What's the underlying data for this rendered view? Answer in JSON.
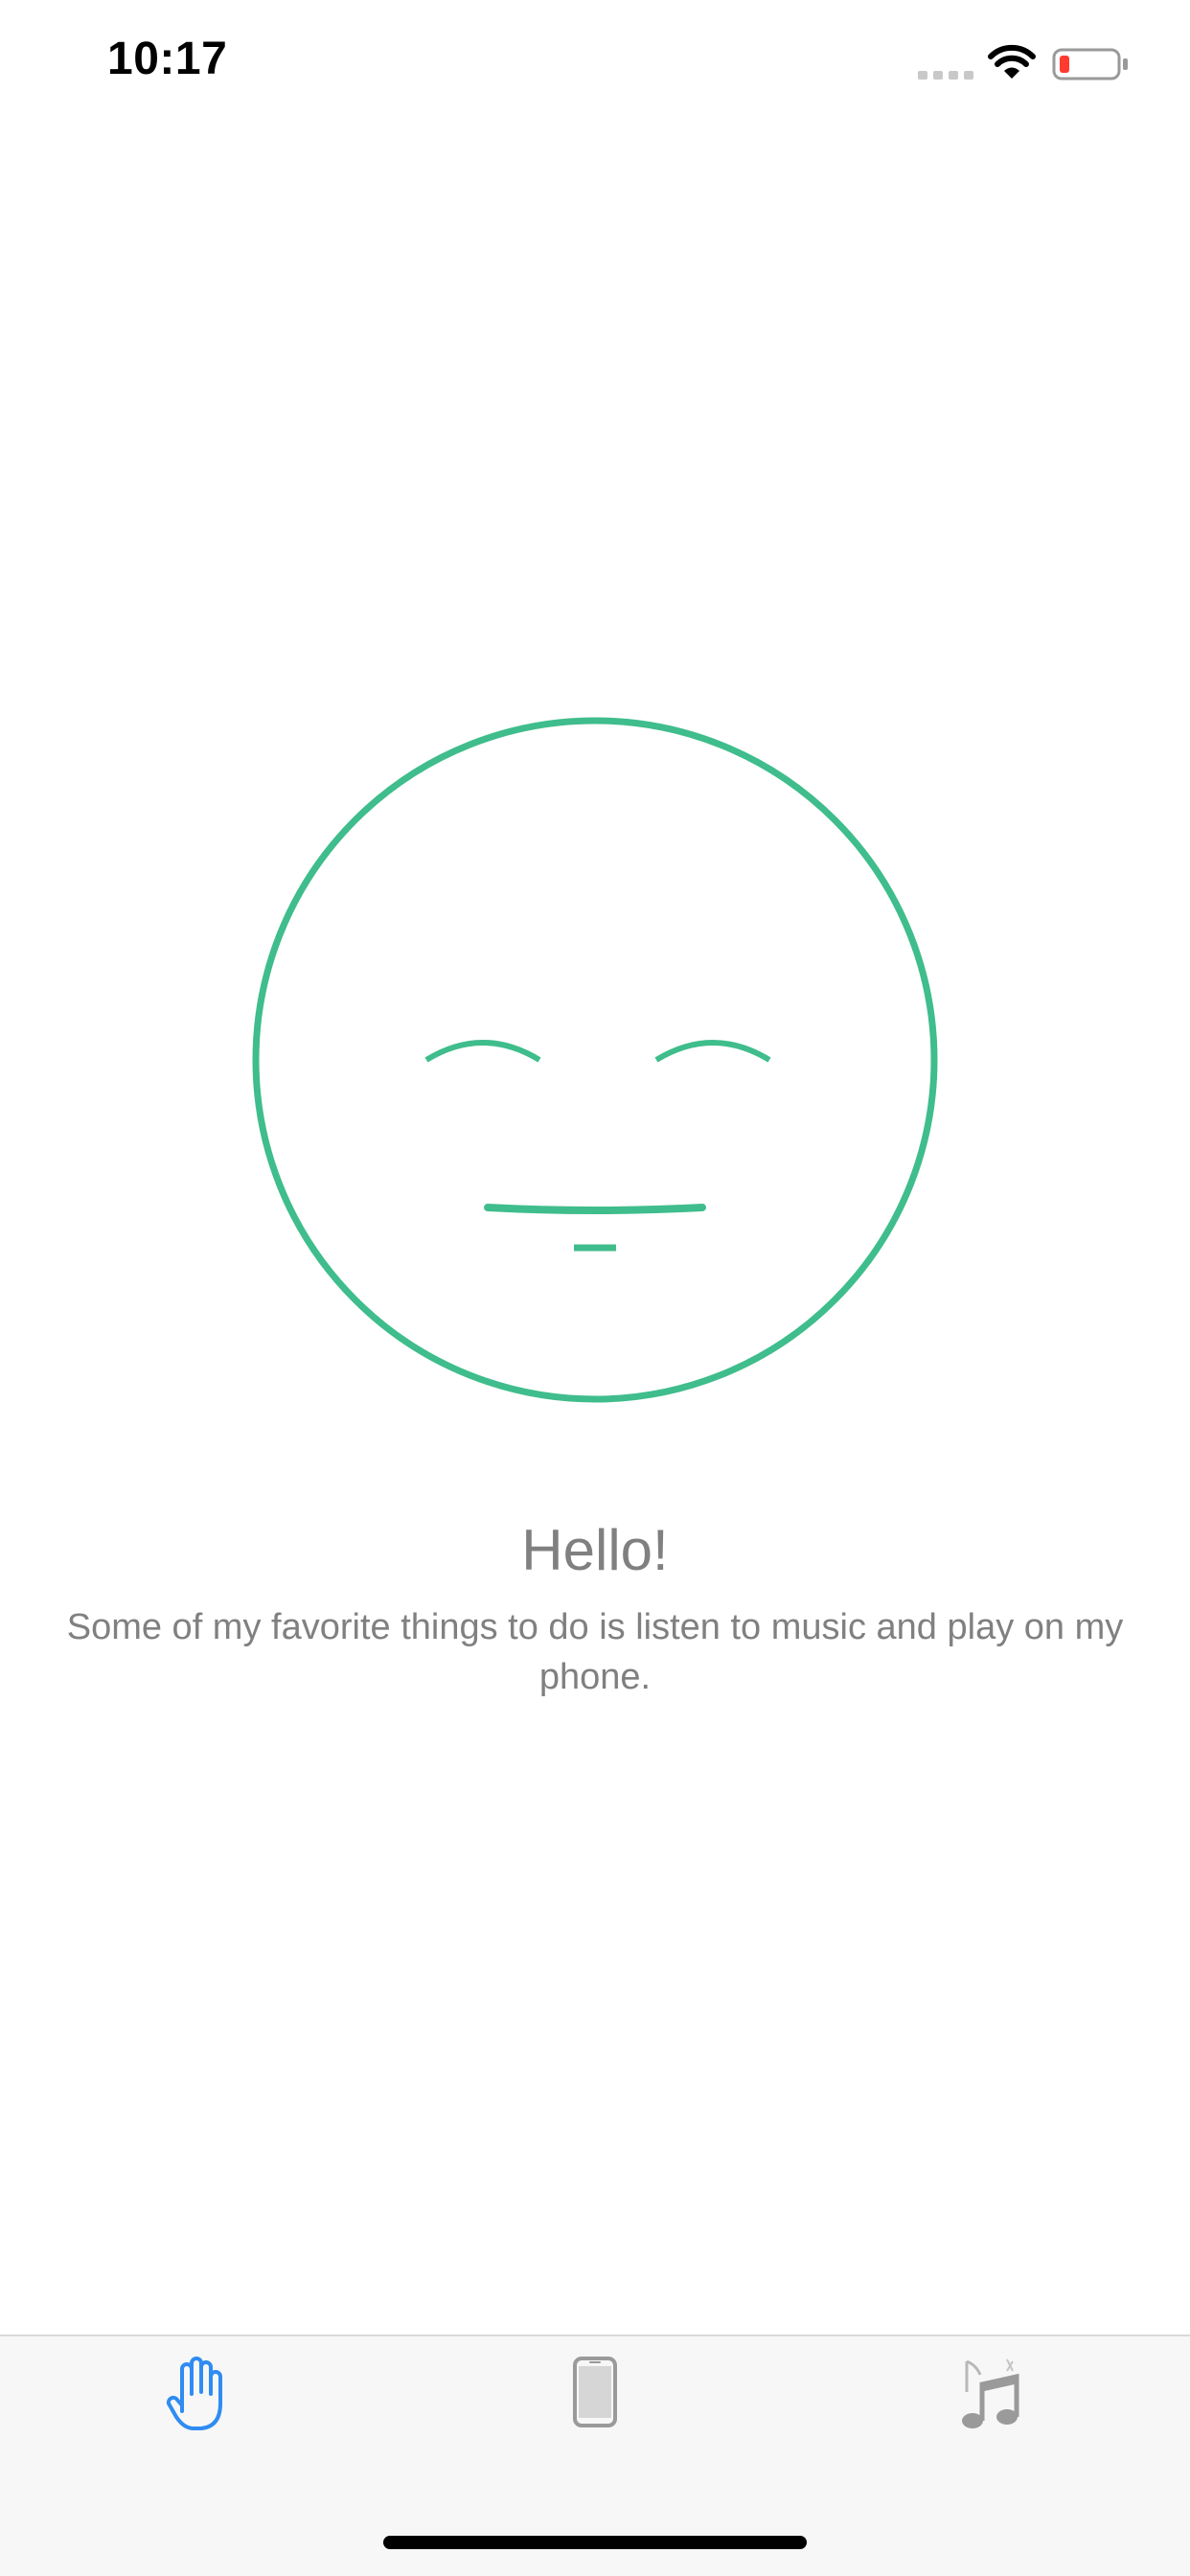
{
  "status_bar": {
    "time": "10:17"
  },
  "colors": {
    "face_stroke": "#3fbd8c",
    "text_gray": "#808080",
    "tab_active": "#2f8cf2",
    "tab_inactive": "#9a9a9a",
    "battery_low": "#ff3b30"
  },
  "main": {
    "title": "Hello!",
    "description": "Some of my favorite things to do is listen to music and play on my phone."
  },
  "tab_bar": {
    "selected_index": 0,
    "tabs": [
      {
        "icon": "hand-icon",
        "active": true
      },
      {
        "icon": "phone-icon",
        "active": false
      },
      {
        "icon": "music-note-icon",
        "active": false
      }
    ]
  }
}
